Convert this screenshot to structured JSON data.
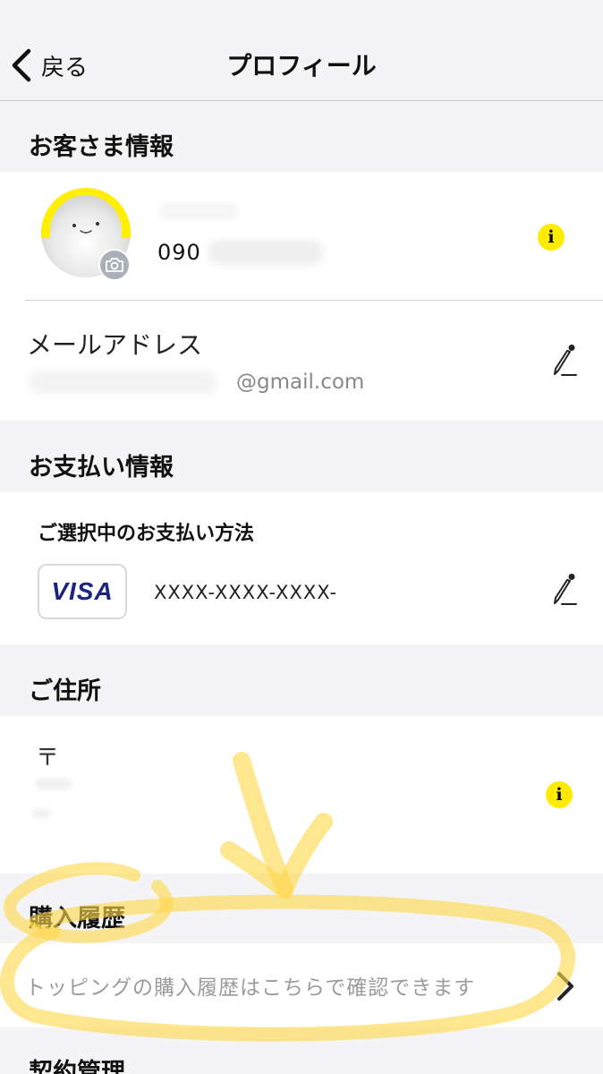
{
  "nav": {
    "back_label": "戻る",
    "title": "プロフィール"
  },
  "customer": {
    "section_title": "お客さま情報",
    "phone_prefix": "090",
    "info_icon": "i",
    "email_label": "メールアドレス",
    "email_domain": "@gmail.com"
  },
  "payment": {
    "section_title": "お支払い情報",
    "method_label": "ご選択中のお支払い方法",
    "card_brand": "VISA",
    "card_number": "XXXX-XXXX-XXXX-"
  },
  "address": {
    "section_title": "ご住所",
    "postal_mark": "〒",
    "info_icon": "i"
  },
  "history": {
    "section_title": "購入履歴",
    "link_text": "トッピングの購入履歴はこちらで確認できます"
  },
  "contract": {
    "section_title": "契約管理"
  },
  "colors": {
    "background": "#f4f4f6",
    "card": "#ffffff",
    "accent_yellow": "#ffeb00",
    "highlighter": "#ffd84a",
    "visa_blue": "#1a237e"
  },
  "icons": {
    "back": "chevron-left-icon",
    "camera": "camera-icon",
    "info": "info-icon",
    "edit": "pencil-icon",
    "forward": "chevron-right-icon"
  }
}
